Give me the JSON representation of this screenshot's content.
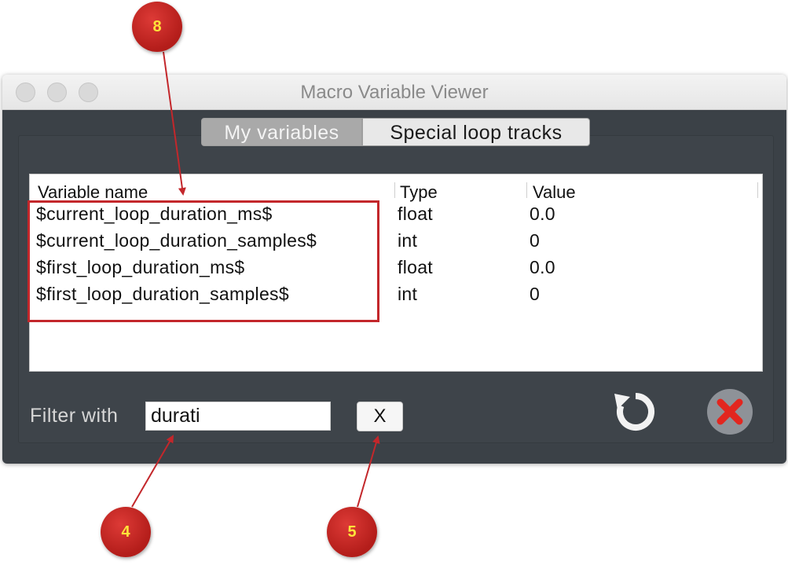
{
  "window": {
    "title": "Macro Variable Viewer"
  },
  "tabs": [
    {
      "label": "My variables",
      "active": true
    },
    {
      "label": "Special loop tracks",
      "active": false
    }
  ],
  "table": {
    "headers": [
      "Variable name",
      "Type",
      "Value"
    ],
    "rows": [
      {
        "name": "$current_loop_duration_ms$",
        "type": "float",
        "value": "0.0"
      },
      {
        "name": "$current_loop_duration_samples$",
        "type": "int",
        "value": "0"
      },
      {
        "name": "$first_loop_duration_ms$",
        "type": "float",
        "value": "0.0"
      },
      {
        "name": "$first_loop_duration_samples$",
        "type": "int",
        "value": "0"
      }
    ]
  },
  "filter": {
    "label": "Filter with",
    "value": "durati",
    "clear_label": "X"
  },
  "buttons": {
    "refresh_icon": "refresh-icon",
    "close_icon": "close-icon"
  },
  "annotations": {
    "badge_8": "8",
    "badge_4": "4",
    "badge_5": "5",
    "color": "#c3272b",
    "number_color": "#ffe33a"
  }
}
